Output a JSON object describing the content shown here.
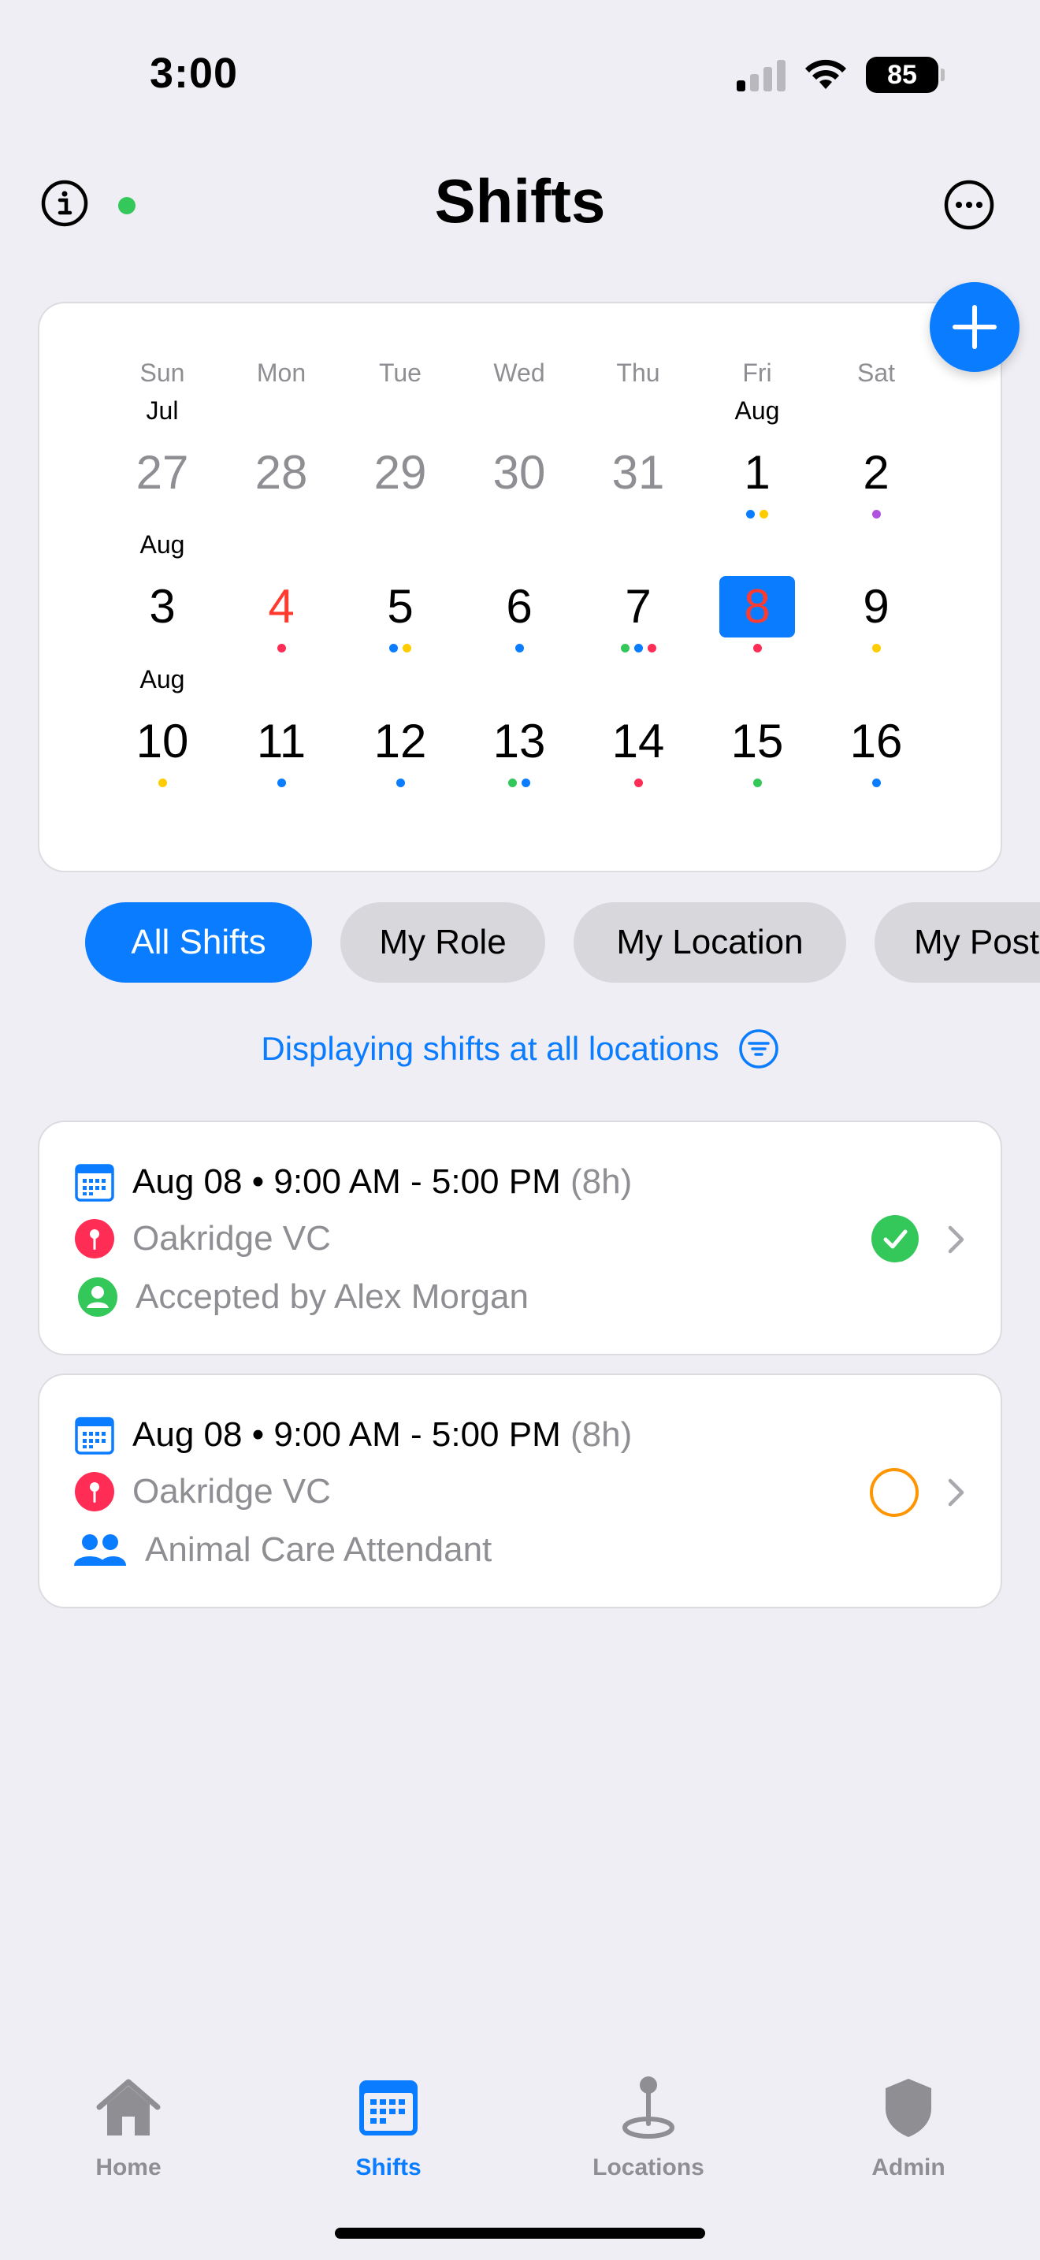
{
  "status_bar": {
    "time": "3:00",
    "battery": "85"
  },
  "header": {
    "title": "Shifts",
    "info_icon": "info-circle-icon",
    "more_icon": "ellipsis-circle-icon"
  },
  "colors": {
    "accent": "#0a7cff",
    "red": "#ff3b30",
    "green": "#34c759",
    "orange": "#ff9500",
    "yellow": "#ffcc00",
    "purple": "#af52de",
    "pink": "#ff2d55"
  },
  "calendar": {
    "weekdays": [
      "Sun",
      "Mon",
      "Tue",
      "Wed",
      "Thu",
      "Fri",
      "Sat"
    ],
    "weeks": [
      [
        {
          "month": "Jul",
          "day": "27",
          "style": "gray",
          "dots": []
        },
        {
          "month": "",
          "day": "28",
          "style": "gray",
          "dots": []
        },
        {
          "month": "",
          "day": "29",
          "style": "gray",
          "dots": []
        },
        {
          "month": "",
          "day": "30",
          "style": "gray",
          "dots": []
        },
        {
          "month": "",
          "day": "31",
          "style": "gray",
          "dots": []
        },
        {
          "month": "Aug",
          "day": "1",
          "style": "normal",
          "dots": [
            "blue",
            "yellow"
          ]
        },
        {
          "month": "",
          "day": "2",
          "style": "normal",
          "dots": [
            "purple"
          ]
        }
      ],
      [
        {
          "month": "Aug",
          "day": "3",
          "style": "normal",
          "dots": []
        },
        {
          "month": "",
          "day": "4",
          "style": "red",
          "dots": [
            "pink"
          ]
        },
        {
          "month": "",
          "day": "5",
          "style": "normal",
          "dots": [
            "blue",
            "yellow"
          ]
        },
        {
          "month": "",
          "day": "6",
          "style": "normal",
          "dots": [
            "blue"
          ]
        },
        {
          "month": "",
          "day": "7",
          "style": "normal",
          "dots": [
            "green",
            "blue",
            "pink"
          ]
        },
        {
          "month": "",
          "day": "8",
          "style": "selected",
          "dots": [
            "pink"
          ]
        },
        {
          "month": "",
          "day": "9",
          "style": "normal",
          "dots": [
            "yellow"
          ]
        }
      ],
      [
        {
          "month": "Aug",
          "day": "10",
          "style": "normal",
          "dots": [
            "yellow"
          ]
        },
        {
          "month": "",
          "day": "11",
          "style": "normal",
          "dots": [
            "blue"
          ]
        },
        {
          "month": "",
          "day": "12",
          "style": "normal",
          "dots": [
            "blue"
          ]
        },
        {
          "month": "",
          "day": "13",
          "style": "normal",
          "dots": [
            "green",
            "blue"
          ]
        },
        {
          "month": "",
          "day": "14",
          "style": "normal",
          "dots": [
            "pink"
          ]
        },
        {
          "month": "",
          "day": "15",
          "style": "normal",
          "dots": [
            "green"
          ]
        },
        {
          "month": "",
          "day": "16",
          "style": "normal",
          "dots": [
            "blue"
          ]
        }
      ]
    ]
  },
  "filters": {
    "chips": [
      "All Shifts",
      "My Role",
      "My Location",
      "My Post"
    ],
    "active": "All Shifts",
    "description": "Displaying shifts at all locations"
  },
  "shifts": [
    {
      "date": "Aug 08",
      "time": "9:00 AM - 5:00 PM",
      "duration": "(8h)",
      "location": "Oakridge VC",
      "detail": "Accepted by Alex Morgan",
      "detail_icon": "person-circle-icon",
      "status": "accepted"
    },
    {
      "date": "Aug 08",
      "time": "9:00 AM - 5:00 PM",
      "duration": "(8h)",
      "location": "Oakridge VC",
      "detail": "Animal Care Attendant",
      "detail_icon": "people-icon",
      "status": "open"
    }
  ],
  "tabs": [
    {
      "label": "Home",
      "icon": "house-icon",
      "active": false
    },
    {
      "label": "Shifts",
      "icon": "calendar-icon",
      "active": true
    },
    {
      "label": "Locations",
      "icon": "map-pin-icon",
      "active": false
    },
    {
      "label": "Admin",
      "icon": "shield-icon",
      "active": false
    }
  ]
}
